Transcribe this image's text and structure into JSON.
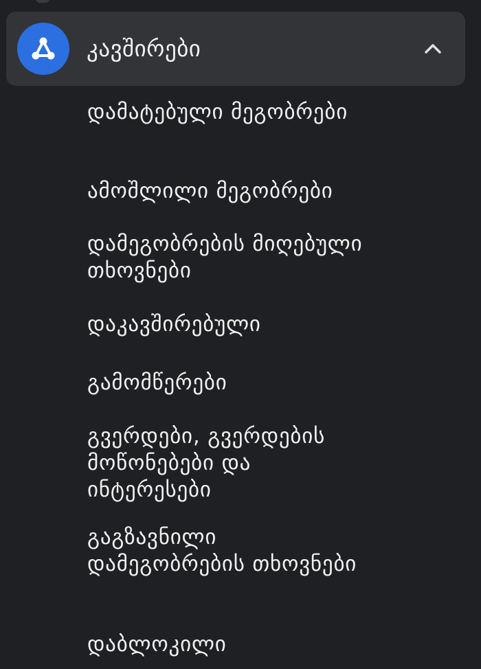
{
  "section": {
    "title": "კავშირები",
    "icon": "connections-icon",
    "accent_color": "#2b6fe0",
    "expanded": true
  },
  "items": [
    {
      "label": "დამატებული მეგობრები"
    },
    {
      "label": "ამოშლილი მეგობრები"
    },
    {
      "label": "დამეგობრების მიღებული თხოვნები"
    },
    {
      "label": "დაკავშირებული"
    },
    {
      "label": "გამომწერები"
    },
    {
      "label": "გვერდები, გვერდების მოწონებები და ინტერესები"
    },
    {
      "label": "გაგზავნილი დამეგობრების თხოვნები"
    },
    {
      "label": "დაბლოკილი"
    }
  ]
}
